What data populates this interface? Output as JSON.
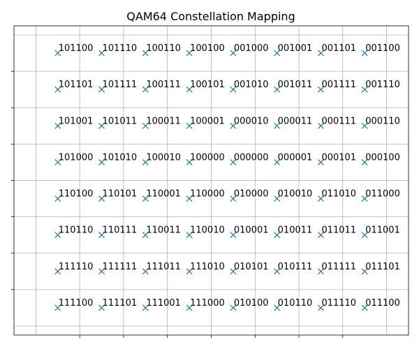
{
  "chart_data": {
    "type": "scatter",
    "title": "QAM64 Constellation Mapping",
    "xlabel": "",
    "ylabel": "",
    "xlim": [
      -9,
      9
    ],
    "ylim": [
      -8.5,
      8.5
    ],
    "x_ticks": [
      -7,
      -5,
      -3,
      -1,
      1,
      3,
      5,
      7
    ],
    "y_ticks": [
      -7,
      -5,
      -3,
      -1,
      1,
      3,
      5,
      7
    ],
    "grid": true,
    "marker": "x",
    "marker_color": "#1f77b4",
    "points": [
      {
        "x": -7,
        "y": 7,
        "label": "101100"
      },
      {
        "x": -5,
        "y": 7,
        "label": "101110"
      },
      {
        "x": -3,
        "y": 7,
        "label": "100110"
      },
      {
        "x": -1,
        "y": 7,
        "label": "100100"
      },
      {
        "x": 1,
        "y": 7,
        "label": "001000"
      },
      {
        "x": 3,
        "y": 7,
        "label": "001001"
      },
      {
        "x": 5,
        "y": 7,
        "label": "001101"
      },
      {
        "x": 7,
        "y": 7,
        "label": "001100"
      },
      {
        "x": -7,
        "y": 5,
        "label": "101101"
      },
      {
        "x": -5,
        "y": 5,
        "label": "101111"
      },
      {
        "x": -3,
        "y": 5,
        "label": "100111"
      },
      {
        "x": -1,
        "y": 5,
        "label": "100101"
      },
      {
        "x": 1,
        "y": 5,
        "label": "001010"
      },
      {
        "x": 3,
        "y": 5,
        "label": "001011"
      },
      {
        "x": 5,
        "y": 5,
        "label": "001111"
      },
      {
        "x": 7,
        "y": 5,
        "label": "001110"
      },
      {
        "x": -7,
        "y": 3,
        "label": "101001"
      },
      {
        "x": -5,
        "y": 3,
        "label": "101011"
      },
      {
        "x": -3,
        "y": 3,
        "label": "100011"
      },
      {
        "x": -1,
        "y": 3,
        "label": "100001"
      },
      {
        "x": 1,
        "y": 3,
        "label": "000010"
      },
      {
        "x": 3,
        "y": 3,
        "label": "000011"
      },
      {
        "x": 5,
        "y": 3,
        "label": "000111"
      },
      {
        "x": 7,
        "y": 3,
        "label": "000110"
      },
      {
        "x": -7,
        "y": 1,
        "label": "101000"
      },
      {
        "x": -5,
        "y": 1,
        "label": "101010"
      },
      {
        "x": -3,
        "y": 1,
        "label": "100010"
      },
      {
        "x": -1,
        "y": 1,
        "label": "100000"
      },
      {
        "x": 1,
        "y": 1,
        "label": "000000"
      },
      {
        "x": 3,
        "y": 1,
        "label": "000001"
      },
      {
        "x": 5,
        "y": 1,
        "label": "000101"
      },
      {
        "x": 7,
        "y": 1,
        "label": "000100"
      },
      {
        "x": -7,
        "y": -1,
        "label": "110100"
      },
      {
        "x": -5,
        "y": -1,
        "label": "110101"
      },
      {
        "x": -3,
        "y": -1,
        "label": "110001"
      },
      {
        "x": -1,
        "y": -1,
        "label": "110000"
      },
      {
        "x": 1,
        "y": -1,
        "label": "010000"
      },
      {
        "x": 3,
        "y": -1,
        "label": "010010"
      },
      {
        "x": 5,
        "y": -1,
        "label": "011010"
      },
      {
        "x": 7,
        "y": -1,
        "label": "011000"
      },
      {
        "x": -7,
        "y": -3,
        "label": "110110"
      },
      {
        "x": -5,
        "y": -3,
        "label": "110111"
      },
      {
        "x": -3,
        "y": -3,
        "label": "110011"
      },
      {
        "x": -1,
        "y": -3,
        "label": "110010"
      },
      {
        "x": 1,
        "y": -3,
        "label": "010001"
      },
      {
        "x": 3,
        "y": -3,
        "label": "010011"
      },
      {
        "x": 5,
        "y": -3,
        "label": "011011"
      },
      {
        "x": 7,
        "y": -3,
        "label": "011001"
      },
      {
        "x": -7,
        "y": -5,
        "label": "111110"
      },
      {
        "x": -5,
        "y": -5,
        "label": "111111"
      },
      {
        "x": -3,
        "y": -5,
        "label": "111011"
      },
      {
        "x": -1,
        "y": -5,
        "label": "111010"
      },
      {
        "x": 1,
        "y": -5,
        "label": "010101"
      },
      {
        "x": 3,
        "y": -5,
        "label": "010111"
      },
      {
        "x": 5,
        "y": -5,
        "label": "011111"
      },
      {
        "x": 7,
        "y": -5,
        "label": "011101"
      },
      {
        "x": -7,
        "y": -7,
        "label": "111100"
      },
      {
        "x": -5,
        "y": -7,
        "label": "111101"
      },
      {
        "x": -3,
        "y": -7,
        "label": "111001"
      },
      {
        "x": -1,
        "y": -7,
        "label": "111000"
      },
      {
        "x": 1,
        "y": -7,
        "label": "010100"
      },
      {
        "x": 3,
        "y": -7,
        "label": "010110"
      },
      {
        "x": 5,
        "y": -7,
        "label": "011110"
      },
      {
        "x": 7,
        "y": -7,
        "label": "011100"
      }
    ]
  }
}
